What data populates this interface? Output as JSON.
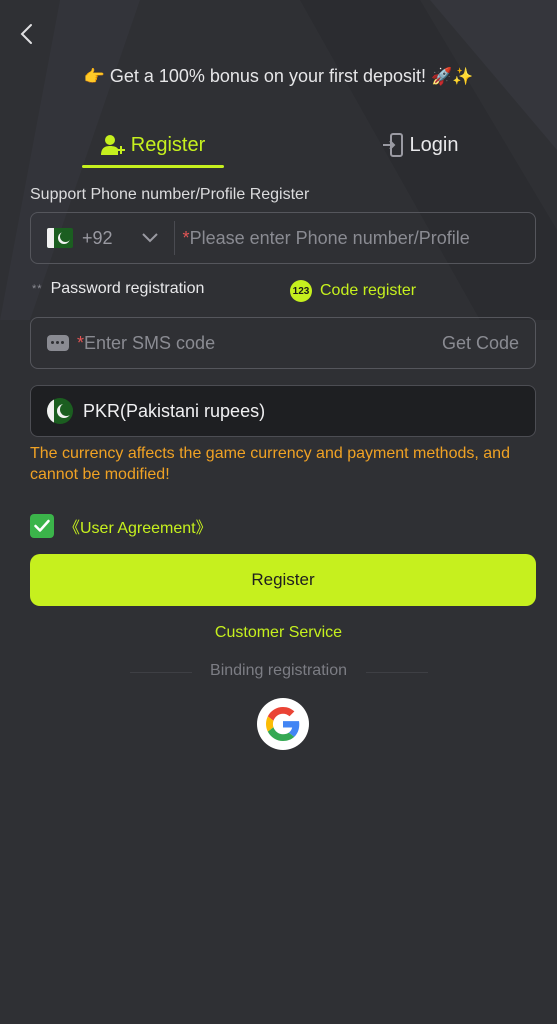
{
  "promo": {
    "icon_left": "👉",
    "text": "Get a 100% bonus on your first deposit!",
    "icon_right": "🚀✨"
  },
  "tabs": [
    {
      "label": "Register",
      "icon": "user-add-icon",
      "active": true
    },
    {
      "label": "Login",
      "icon": "login-door-icon",
      "active": false
    }
  ],
  "section_label": "Support Phone number/Profile Register",
  "phone": {
    "country_code": "+92",
    "required_mark": "*",
    "placeholder": "Please enter Phone number/Profile"
  },
  "methods": {
    "password": {
      "stars": "**",
      "label": "Password registration"
    },
    "code": {
      "badge": "123",
      "label": "Code register"
    }
  },
  "sms": {
    "required_mark": "*",
    "placeholder": "Enter SMS code",
    "get_code": "Get Code"
  },
  "currency": {
    "label": "PKR(Pakistani rupees)"
  },
  "warning": "The currency affects the game currency and payment methods, and cannot be modified!",
  "agreement": {
    "checked": true,
    "label": "《User Agreement》"
  },
  "register_button": "Register",
  "customer_service": "Customer Service",
  "binding_label": "Binding registration",
  "colors": {
    "accent": "#c6f01e",
    "background": "#2f3034",
    "warning": "#f0a224",
    "checkbox": "#3bb44a"
  }
}
